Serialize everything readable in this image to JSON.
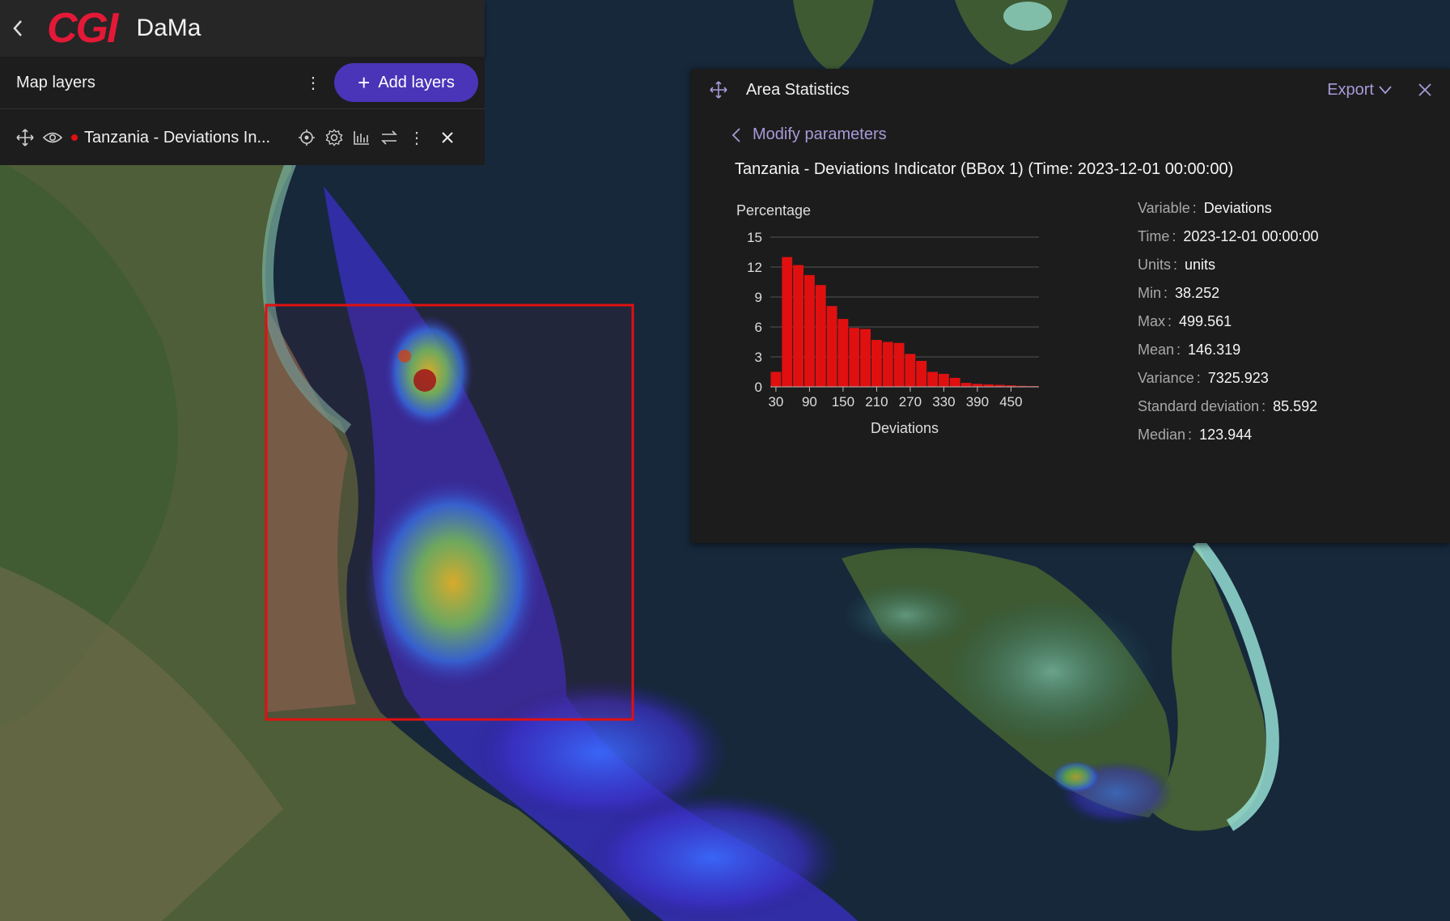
{
  "header": {
    "logo_text": "CGI",
    "app_name": "DaMa"
  },
  "layers_panel": {
    "title": "Map layers",
    "add_button_label": "Add layers",
    "layer": {
      "name": "Tanzania - Deviations In...",
      "color": "#e01010"
    }
  },
  "area_statistics": {
    "title": "Area Statistics",
    "export_label": "Export",
    "modify_label": "Modify parameters",
    "subtitle": "Tanzania - Deviations Indicator (BBox 1) (Time: 2023-12-01 00:00:00)",
    "properties": [
      {
        "key": "Variable",
        "value": "Deviations"
      },
      {
        "key": "Time",
        "value": "2023-12-01 00:00:00"
      },
      {
        "key": "Units",
        "value": "units"
      },
      {
        "key": "Min",
        "value": "38.252"
      },
      {
        "key": "Max",
        "value": "499.561"
      },
      {
        "key": "Mean",
        "value": "146.319"
      },
      {
        "key": "Variance",
        "value": "7325.923"
      },
      {
        "key": "Standard deviation",
        "value": "85.592"
      },
      {
        "key": "Median",
        "value": "123.944"
      }
    ]
  },
  "chart_data": {
    "type": "bar",
    "ylabel": "Percentage",
    "xlabel": "Deviations",
    "ylim": [
      0,
      15
    ],
    "xlim": [
      20,
      500
    ],
    "yticks": [
      "0",
      "3",
      "6",
      "9",
      "12",
      "15"
    ],
    "xticks": [
      "30",
      "90",
      "150",
      "210",
      "270",
      "330",
      "390",
      "450"
    ],
    "bar_color": "#e01010",
    "bin_width": 20,
    "bin_starts": [
      20,
      40,
      60,
      80,
      100,
      120,
      140,
      160,
      180,
      200,
      220,
      240,
      260,
      280,
      300,
      320,
      340,
      360,
      380,
      400,
      420,
      440,
      460,
      480
    ],
    "values": [
      1.5,
      13.0,
      12.2,
      11.2,
      10.2,
      8.1,
      6.8,
      5.9,
      5.8,
      4.7,
      4.5,
      4.4,
      3.3,
      2.6,
      1.5,
      1.3,
      0.9,
      0.4,
      0.3,
      0.25,
      0.2,
      0.15,
      0.1,
      0.08
    ],
    "grid": true
  },
  "map": {
    "bbox_color": "#e01010"
  }
}
